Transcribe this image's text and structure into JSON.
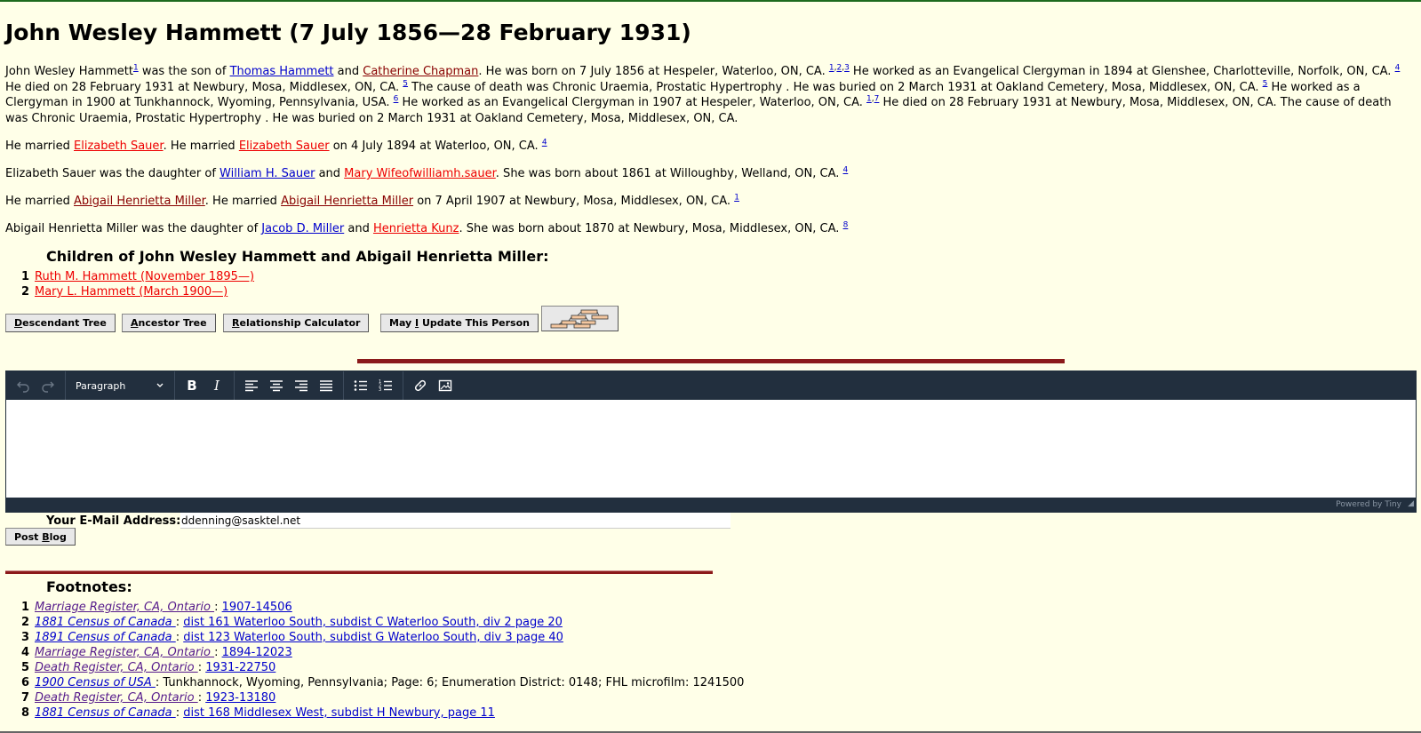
{
  "title": "John Wesley Hammett (7 July 1856—28 February 1931)",
  "bio": {
    "s1_name": "John Wesley Hammett",
    "s1_fn": "1",
    "s1_text": " was the son of ",
    "father": "Thomas Hammett",
    "and": " and ",
    "mother": "Catherine Chapman",
    "s2": ". He was born on 7 July 1856 at Hespeler, Waterloo, ON, CA. ",
    "fn_a": "1",
    "fn_b": "2",
    "fn_c": "3",
    "s3": " He worked as an Evangelical Clergyman in 1894 at Glenshee, Charlotteville, Norfolk, ON, CA. ",
    "fn_d": "4",
    "s4": " He died on 28 February 1931 at Newbury, Mosa, Middlesex, ON, CA. ",
    "fn_e": "5",
    "s5": " The cause of death was Chronic Uraemia, Prostatic Hypertrophy . He was buried on 2 March 1931 at Oakland Cemetery, Mosa, Middlesex, ON, CA. ",
    "fn_f": "5",
    "s6": " He worked as a Clergyman in 1900 at Tunkhannock, Wyoming, Pennsylvania, USA. ",
    "fn_g": "6",
    "s7": " He worked as an Evangelical Clergyman in 1907 at Hespeler, Waterloo, ON, CA. ",
    "fn_h": "1",
    "fn_i": "7",
    "s8": " He died on 28 February 1931 at Newbury, Mosa, Middlesex, ON, CA. The cause of death was Chronic Uraemia, Prostatic Hypertrophy . He was buried on 2 March 1931 at Oakland Cemetery, Mosa, Middlesex, ON, CA."
  },
  "marriage1": {
    "pre": "He married ",
    "spouse": "Elizabeth Sauer",
    "mid": ". He married ",
    "spouse2": "Elizabeth Sauer",
    "post": " on 4 July 1894 at Waterloo, ON, CA. ",
    "fn": "4"
  },
  "spouse1_parents": {
    "pre": "Elizabeth Sauer was the daughter of ",
    "father": "William H. Sauer",
    "and": " and ",
    "mother": "Mary Wifeofwilliamh.sauer",
    "post": ". She was born about 1861 at Willoughby, Welland, ON, CA. ",
    "fn": "4"
  },
  "marriage2": {
    "pre": "He married ",
    "spouse": "Abigail Henrietta Miller",
    "mid": ". He married ",
    "spouse2": "Abigail Henrietta Miller",
    "post": " on 7 April 1907 at Newbury, Mosa, Middlesex, ON, CA. ",
    "fn": "1"
  },
  "spouse2_parents": {
    "pre": "Abigail Henrietta Miller was the daughter of ",
    "father": "Jacob D. Miller",
    "and": " and ",
    "mother": "Henrietta Kunz",
    "post": ". She was born about 1870 at Newbury, Mosa, Middlesex, ON, CA. ",
    "fn": "8"
  },
  "children": {
    "title": "Children of John Wesley Hammett and Abigail Henrietta Miller:",
    "items": [
      {
        "n": "1",
        "label": "Ruth M. Hammett (November 1895—)"
      },
      {
        "n": "2",
        "label": "Mary L. Hammett (March 1900—)"
      }
    ]
  },
  "buttons": {
    "descendant_pre": "",
    "descendant_key": "D",
    "descendant_post": "escendant Tree",
    "ancestor_pre": "",
    "ancestor_key": "A",
    "ancestor_post": "ncestor Tree",
    "relationship_pre": "",
    "relationship_key": "R",
    "relationship_post": "elationship Calculator",
    "update_pre": "May ",
    "update_key": "I",
    "update_post": " Update This Person"
  },
  "editor": {
    "format": "Paragraph",
    "powered": "Powered by Tiny"
  },
  "email": {
    "label": "Your E-Mail Address:",
    "value": "ddenning@sasktel.net"
  },
  "post_blog": {
    "pre": "Post ",
    "key": "B",
    "post": "log"
  },
  "footnotes": {
    "title": "Footnotes:",
    "items": [
      {
        "n": "1",
        "source": "Marriage Register, CA, Ontario ",
        "sep": " : ",
        "detail": "1907-14506",
        "visited": true,
        "detail_link": true
      },
      {
        "n": "2",
        "source": "1881 Census of Canada ",
        "sep": " : ",
        "detail": "dist 161 Waterloo South, subdist C Waterloo South, div 2 page 20",
        "visited": false,
        "detail_link": true
      },
      {
        "n": "3",
        "source": "1891 Census of Canada ",
        "sep": " : ",
        "detail": "dist 123 Waterloo South, subdist G Waterloo South, div 3 page 40",
        "visited": false,
        "detail_link": true
      },
      {
        "n": "4",
        "source": "Marriage Register, CA, Ontario ",
        "sep": " : ",
        "detail": "1894-12023",
        "visited": true,
        "detail_link": true
      },
      {
        "n": "5",
        "source": "Death Register, CA, Ontario ",
        "sep": " : ",
        "detail": "1931-22750",
        "visited": true,
        "detail_link": true
      },
      {
        "n": "6",
        "source": "1900 Census of USA ",
        "sep": " : ",
        "detail": "Tunkhannock, Wyoming, Pennsylvania; Page: 6; Enumeration District: 0148; FHL microfilm: 1241500",
        "visited": false,
        "detail_link": false
      },
      {
        "n": "7",
        "source": "Death Register, CA, Ontario ",
        "sep": " : ",
        "detail": "1923-13180",
        "visited": true,
        "detail_link": true
      },
      {
        "n": "8",
        "source": "1881 Census of Canada ",
        "sep": " : ",
        "detail": "dist 168 Middlesex West, subdist H Newbury, page 11",
        "visited": false,
        "detail_link": true
      }
    ]
  }
}
